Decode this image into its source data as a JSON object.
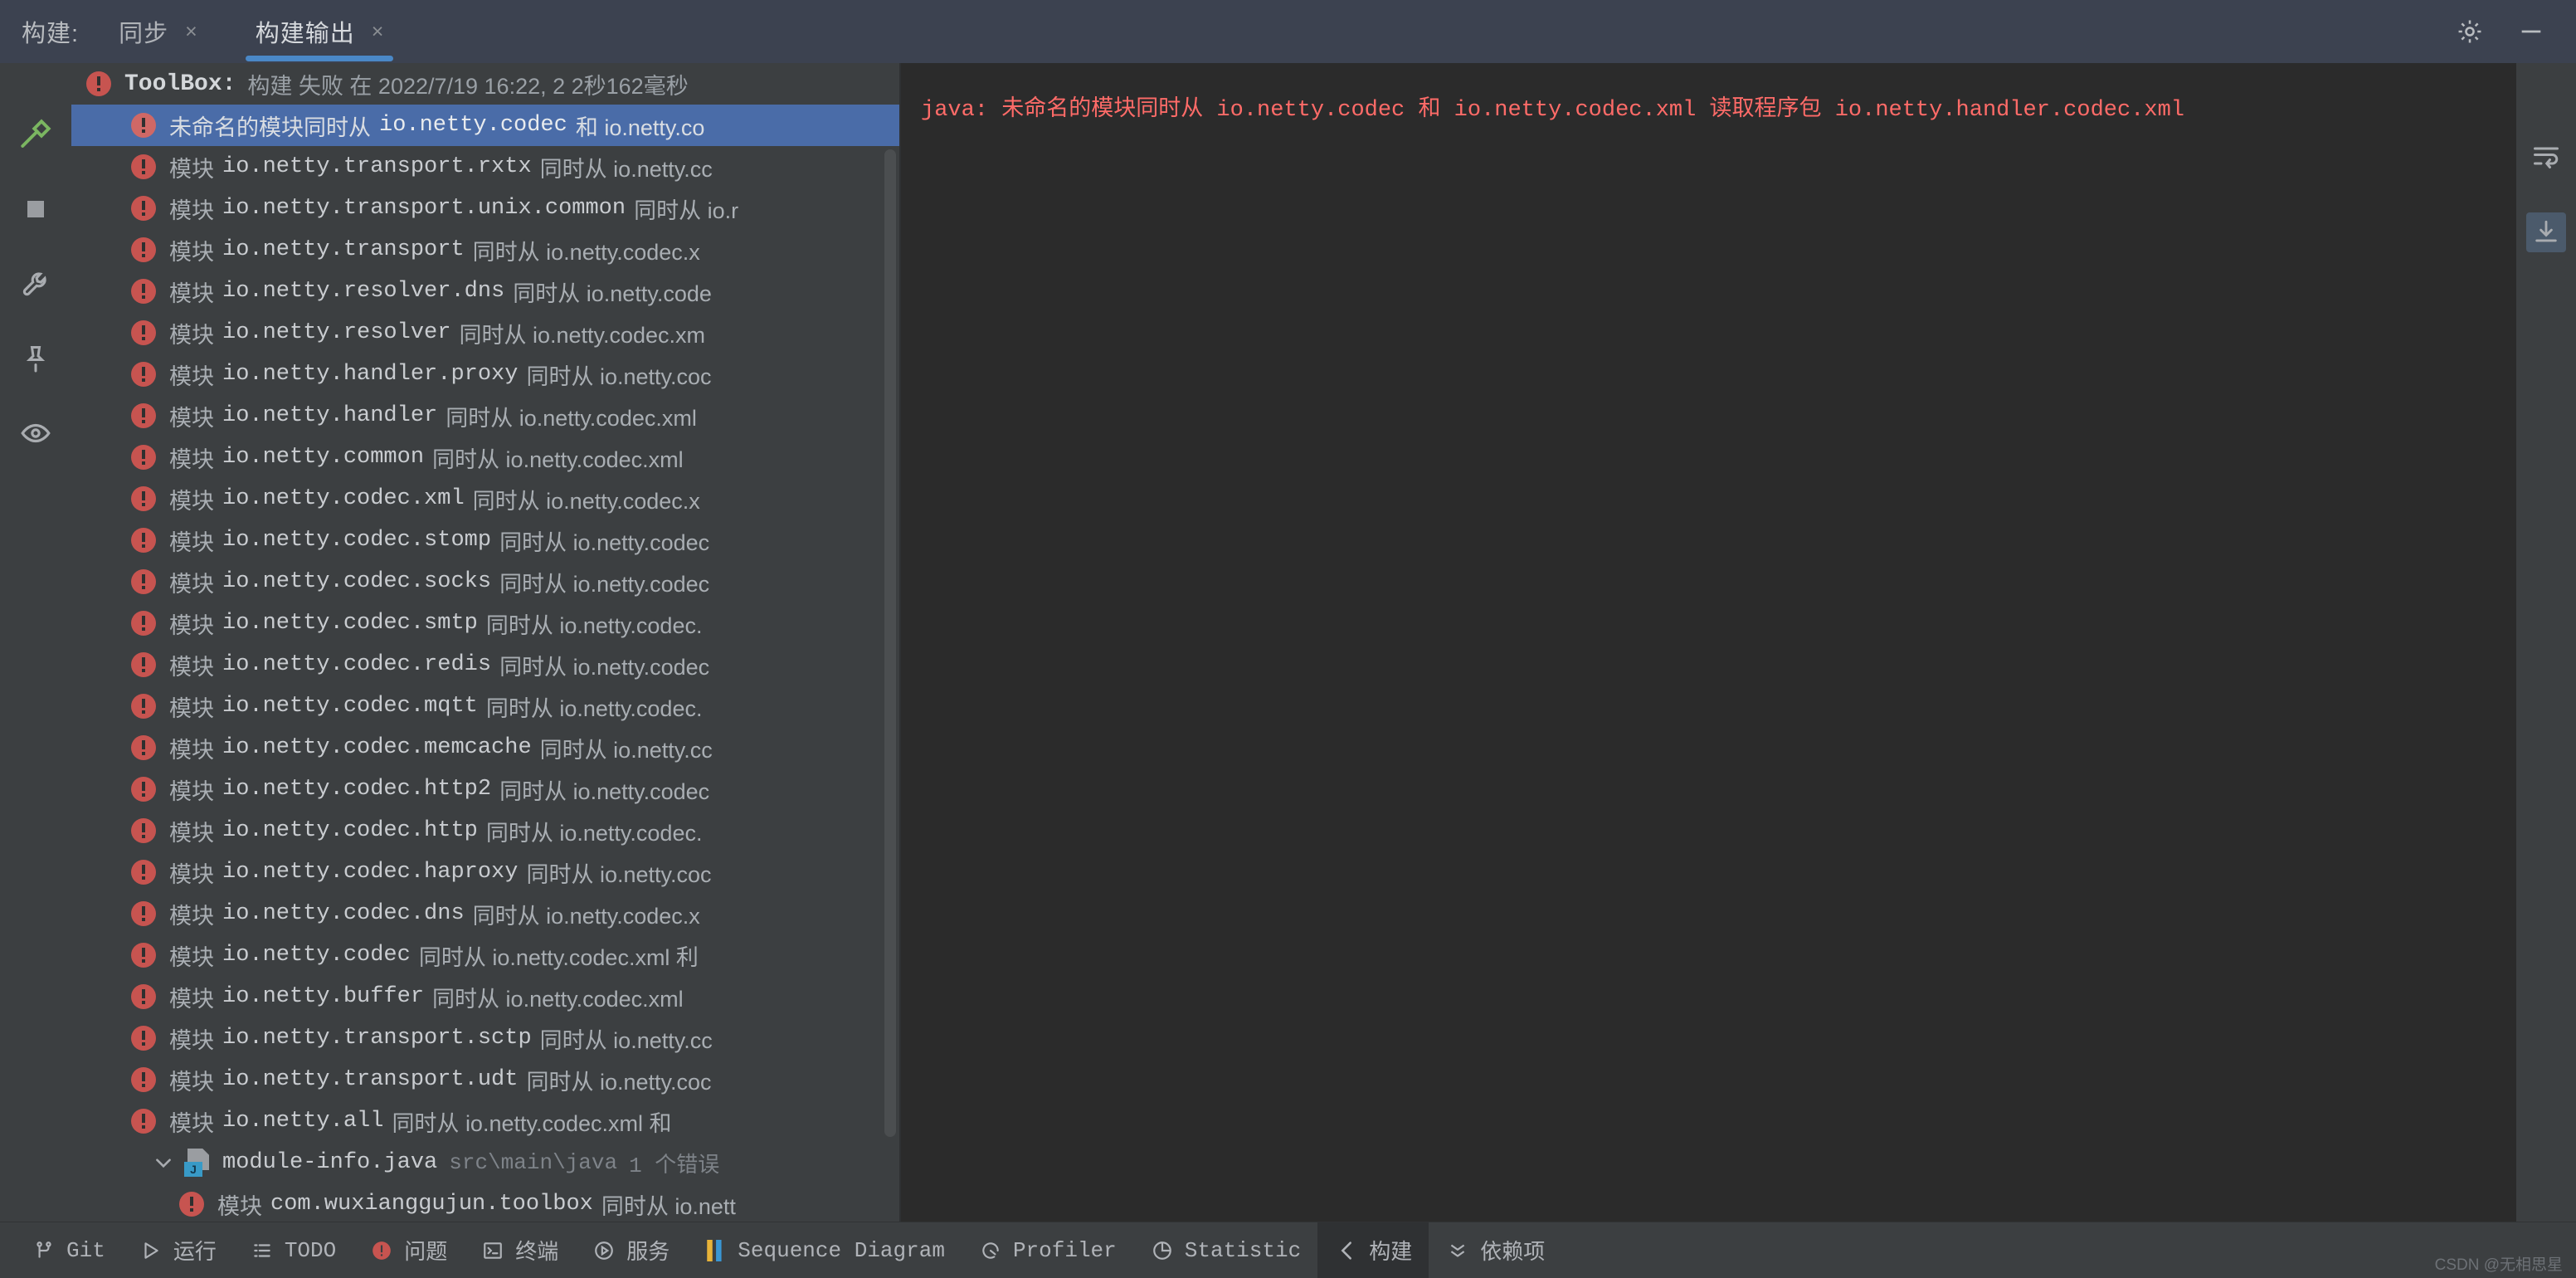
{
  "window": {
    "tool_window_title": "构建:",
    "tabs": [
      {
        "label": "同步",
        "active": false,
        "close": "×"
      },
      {
        "label": "构建输出",
        "active": true,
        "close": "×"
      }
    ],
    "header_actions": [
      {
        "name": "settings-icon",
        "glyph": "gear"
      },
      {
        "name": "minimize-icon",
        "glyph": "minus"
      }
    ]
  },
  "left_toolbar": [
    {
      "name": "build-hammer-icon",
      "glyph": "hammer"
    },
    {
      "name": "stop-icon",
      "glyph": "square"
    },
    {
      "name": "wrench-icon",
      "glyph": "wrench"
    },
    {
      "name": "pin-icon",
      "glyph": "pin"
    },
    {
      "name": "eye-icon",
      "glyph": "eye"
    }
  ],
  "right_toolbar": [
    {
      "name": "wrap-text-icon",
      "glyph": "lines"
    },
    {
      "name": "export-icon",
      "glyph": "download"
    }
  ],
  "tree": {
    "root": {
      "label_strong": "ToolBox:",
      "label_rest": "构建 失败 在 2022/7/19 16:22,  2 2秒162毫秒",
      "status_icon": "error-icon"
    },
    "items": [
      {
        "prefix": "未命名的模块同时从",
        "mono": "io.netty.codec",
        "suffix": "和 io.netty.co",
        "selected": true
      },
      {
        "prefix": "模块",
        "mono": "io.netty.transport.rxtx",
        "suffix": "同时从 io.netty.cc",
        "selected": false
      },
      {
        "prefix": "模块",
        "mono": "io.netty.transport.unix.common",
        "suffix": "同时从 io.r",
        "selected": false
      },
      {
        "prefix": "模块",
        "mono": "io.netty.transport",
        "suffix": "同时从 io.netty.codec.x",
        "selected": false
      },
      {
        "prefix": "模块",
        "mono": "io.netty.resolver.dns",
        "suffix": "同时从 io.netty.code",
        "selected": false
      },
      {
        "prefix": "模块",
        "mono": "io.netty.resolver",
        "suffix": "同时从 io.netty.codec.xm",
        "selected": false
      },
      {
        "prefix": "模块",
        "mono": "io.netty.handler.proxy",
        "suffix": "同时从 io.netty.coc",
        "selected": false
      },
      {
        "prefix": "模块",
        "mono": "io.netty.handler",
        "suffix": "同时从 io.netty.codec.xml",
        "selected": false
      },
      {
        "prefix": "模块",
        "mono": "io.netty.common",
        "suffix": "同时从 io.netty.codec.xml",
        "selected": false
      },
      {
        "prefix": "模块",
        "mono": "io.netty.codec.xml",
        "suffix": "同时从 io.netty.codec.x",
        "selected": false
      },
      {
        "prefix": "模块",
        "mono": "io.netty.codec.stomp",
        "suffix": "同时从 io.netty.codec",
        "selected": false
      },
      {
        "prefix": "模块",
        "mono": "io.netty.codec.socks",
        "suffix": "同时从 io.netty.codec",
        "selected": false
      },
      {
        "prefix": "模块",
        "mono": "io.netty.codec.smtp",
        "suffix": "同时从 io.netty.codec.",
        "selected": false
      },
      {
        "prefix": "模块",
        "mono": "io.netty.codec.redis",
        "suffix": "同时从 io.netty.codec",
        "selected": false
      },
      {
        "prefix": "模块",
        "mono": "io.netty.codec.mqtt",
        "suffix": "同时从 io.netty.codec.",
        "selected": false
      },
      {
        "prefix": "模块",
        "mono": "io.netty.codec.memcache",
        "suffix": "同时从 io.netty.cc",
        "selected": false
      },
      {
        "prefix": "模块",
        "mono": "io.netty.codec.http2",
        "suffix": "同时从 io.netty.codec",
        "selected": false
      },
      {
        "prefix": "模块",
        "mono": "io.netty.codec.http",
        "suffix": "同时从 io.netty.codec.",
        "selected": false
      },
      {
        "prefix": "模块",
        "mono": "io.netty.codec.haproxy",
        "suffix": "同时从 io.netty.coc",
        "selected": false
      },
      {
        "prefix": "模块",
        "mono": "io.netty.codec.dns",
        "suffix": "同时从 io.netty.codec.x",
        "selected": false
      },
      {
        "prefix": "模块",
        "mono": "io.netty.codec",
        "suffix": "同时从 io.netty.codec.xml 利",
        "selected": false
      },
      {
        "prefix": "模块",
        "mono": "io.netty.buffer",
        "suffix": "同时从 io.netty.codec.xml",
        "selected": false
      },
      {
        "prefix": "模块",
        "mono": "io.netty.transport.sctp",
        "suffix": "同时从 io.netty.cc",
        "selected": false
      },
      {
        "prefix": "模块",
        "mono": "io.netty.transport.udt",
        "suffix": "同时从 io.netty.coc",
        "selected": false
      },
      {
        "prefix": "模块",
        "mono": "io.netty.all",
        "suffix": "同时从 io.netty.codec.xml 和",
        "selected": false
      }
    ],
    "file_node": {
      "chevron": "⌄",
      "icon": "java-file-icon",
      "badge": "J",
      "name": "module-info.java",
      "path": "src\\main\\java",
      "error_count": "1 个错误"
    },
    "file_children": [
      {
        "prefix": "模块",
        "mono": "com.wuxianggujun.toolbox",
        "suffix": "同时从 io.nett"
      }
    ]
  },
  "output": {
    "line": "java: 未命名的模块同时从 io.netty.codec 和 io.netty.codec.xml 读取程序包 io.netty.handler.codec.xml",
    "color": "#ff6b68"
  },
  "statusbar": {
    "items": [
      {
        "label": "Git",
        "icon": "git-branch-icon",
        "active": false
      },
      {
        "label": "运行",
        "icon": "play-icon",
        "active": false
      },
      {
        "label": "TODO",
        "icon": "list-icon",
        "active": false
      },
      {
        "label": "问题",
        "icon": "error-circle-icon",
        "active": false
      },
      {
        "label": "终端",
        "icon": "terminal-icon",
        "active": false
      },
      {
        "label": "服务",
        "icon": "services-icon",
        "active": false
      },
      {
        "label": "Sequence Diagram",
        "icon": "sequence-diagram-icon",
        "active": false
      },
      {
        "label": "Profiler",
        "icon": "profiler-icon",
        "active": false
      },
      {
        "label": "Statistic",
        "icon": "statistic-icon",
        "active": false
      },
      {
        "label": "构建",
        "icon": "build-hammer-icon",
        "active": true
      },
      {
        "label": "依赖项",
        "icon": "dependencies-icon",
        "active": false
      }
    ],
    "watermark": "CSDN @无相思星"
  }
}
